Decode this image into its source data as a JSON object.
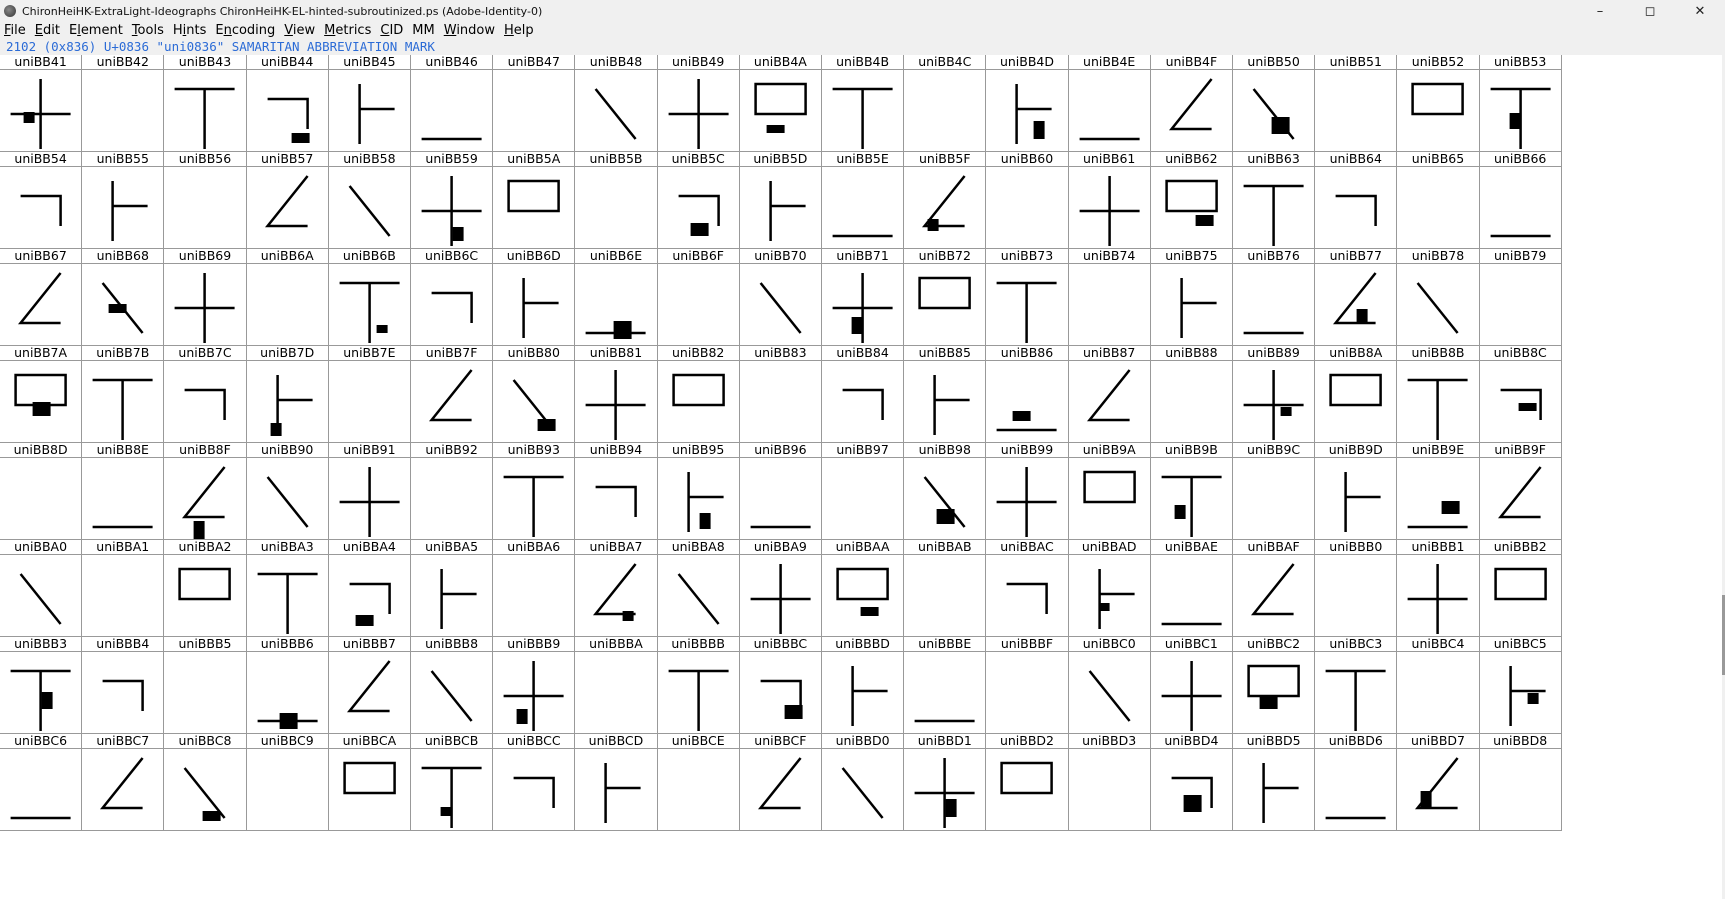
{
  "window": {
    "title": "ChironHeiHK-ExtraLight-Ideographs  ChironHeiHK-EL-hinted-subroutinized.ps (Adobe-Identity-0)",
    "controls": [
      {
        "name": "minimize-button",
        "glyph": "–"
      },
      {
        "name": "maximize-button",
        "glyph": "◻"
      },
      {
        "name": "close-button",
        "glyph": "✕"
      }
    ]
  },
  "menu": [
    {
      "label": "File",
      "ul": 0
    },
    {
      "label": "Edit",
      "ul": 0
    },
    {
      "label": "Element",
      "ul": 1
    },
    {
      "label": "Tools",
      "ul": 0
    },
    {
      "label": "Hints",
      "ul": 1
    },
    {
      "label": "Encoding",
      "ul": 1
    },
    {
      "label": "View",
      "ul": 0
    },
    {
      "label": "Metrics",
      "ul": 0
    },
    {
      "label": "CID",
      "ul": 0
    },
    {
      "label": "MM",
      "ul": -1
    },
    {
      "label": "Window",
      "ul": 0
    },
    {
      "label": "Help",
      "ul": 0
    }
  ],
  "info": {
    "text": "2102 (0x836) U+0836 \"uni0836\" SAMARITAN ABBREVIATION MARK"
  },
  "glyph_grid": {
    "columns": 19,
    "rows": [
      [
        "uniBB41",
        "uniBB42",
        "uniBB43",
        "uniBB44",
        "uniBB45",
        "uniBB46",
        "uniBB47",
        "uniBB48",
        "uniBB49",
        "uniBB4A",
        "uniBB4B",
        "uniBB4C",
        "uniBB4D",
        "uniBB4E",
        "uniBB4F",
        "uniBB50",
        "uniBB51",
        "uniBB52",
        "uniBB53"
      ],
      [
        "uniBB54",
        "uniBB55",
        "uniBB56",
        "uniBB57",
        "uniBB58",
        "uniBB59",
        "uniBB5A",
        "uniBB5B",
        "uniBB5C",
        "uniBB5D",
        "uniBB5E",
        "uniBB5F",
        "uniBB60",
        "uniBB61",
        "uniBB62",
        "uniBB63",
        "uniBB64",
        "uniBB65",
        "uniBB66"
      ],
      [
        "uniBB67",
        "uniBB68",
        "uniBB69",
        "uniBB6A",
        "uniBB6B",
        "uniBB6C",
        "uniBB6D",
        "uniBB6E",
        "uniBB6F",
        "uniBB70",
        "uniBB71",
        "uniBB72",
        "uniBB73",
        "uniBB74",
        "uniBB75",
        "uniBB76",
        "uniBB77",
        "uniBB78",
        "uniBB79"
      ],
      [
        "uniBB7A",
        "uniBB7B",
        "uniBB7C",
        "uniBB7D",
        "uniBB7E",
        "uniBB7F",
        "uniBB80",
        "uniBB81",
        "uniBB82",
        "uniBB83",
        "uniBB84",
        "uniBB85",
        "uniBB86",
        "uniBB87",
        "uniBB88",
        "uniBB89",
        "uniBB8A",
        "uniBB8B",
        "uniBB8C"
      ],
      [
        "uniBB8D",
        "uniBB8E",
        "uniBB8F",
        "uniBB90",
        "uniBB91",
        "uniBB92",
        "uniBB93",
        "uniBB94",
        "uniBB95",
        "uniBB96",
        "uniBB97",
        "uniBB98",
        "uniBB99",
        "uniBB9A",
        "uniBB9B",
        "uniBB9C",
        "uniBB9D",
        "uniBB9E",
        "uniBB9F"
      ],
      [
        "uniBBA0",
        "uniBBA1",
        "uniBBA2",
        "uniBBA3",
        "uniBBA4",
        "uniBBA5",
        "uniBBA6",
        "uniBBA7",
        "uniBBA8",
        "uniBBA9",
        "uniBBAA",
        "uniBBAB",
        "uniBBAC",
        "uniBBAD",
        "uniBBAE",
        "uniBBAF",
        "uniBBB0",
        "uniBBB1",
        "uniBBB2"
      ],
      [
        "uniBBB3",
        "uniBBB4",
        "uniBBB5",
        "uniBBB6",
        "uniBBB7",
        "uniBBB8",
        "uniBBB9",
        "uniBBBA",
        "uniBBBB",
        "uniBBBC",
        "uniBBBD",
        "uniBBBE",
        "uniBBBF",
        "uniBBC0",
        "uniBBC1",
        "uniBBC2",
        "uniBBC3",
        "uniBBC4",
        "uniBBC5"
      ],
      [
        "uniBBC6",
        "uniBBC7",
        "uniBBC8",
        "uniBBC9",
        "uniBBCA",
        "uniBBCB",
        "uniBBCC",
        "uniBBCD",
        "uniBBCE",
        "uniBBCF",
        "uniBBD0",
        "uniBBD1",
        "uniBBD2",
        "uniBBD3",
        "uniBBD4",
        "uniBBD5",
        "uniBBD6",
        "uniBBD7",
        "uniBBD8"
      ]
    ]
  },
  "colors": {
    "info_text": "#2b6bd6",
    "grid_line": "#999999",
    "chrome_bg": "#f0f0f0",
    "glyph_ink": "#000000"
  }
}
